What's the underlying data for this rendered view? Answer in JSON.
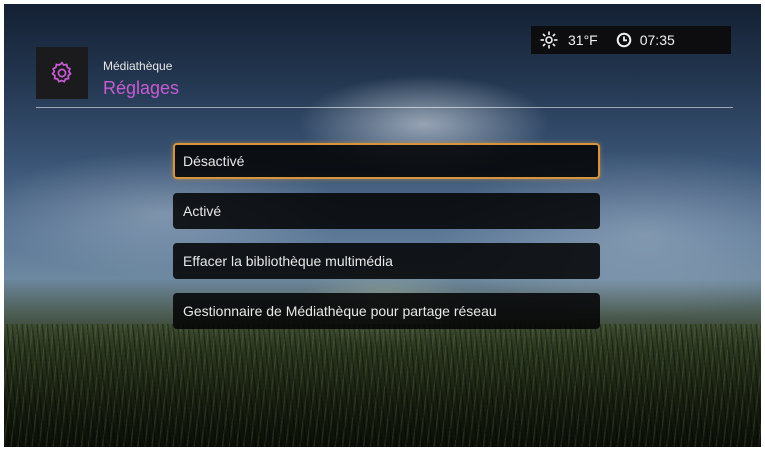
{
  "header": {
    "subtitle": "Médiathèque",
    "title": "Réglages",
    "icon": "gear-icon",
    "title_color": "#c75bd6"
  },
  "status": {
    "weather_icon": "sun-icon",
    "temperature": "31°F",
    "clock_icon": "clock-icon",
    "time": "07:35"
  },
  "menu": {
    "selected_index": 0,
    "accent_color": "#d6943c",
    "items": [
      {
        "label": "Désactivé"
      },
      {
        "label": "Activé"
      },
      {
        "label": "Effacer la bibliothèque multimédia"
      },
      {
        "label": "Gestionnaire de Médiathèque pour partage réseau"
      }
    ]
  }
}
